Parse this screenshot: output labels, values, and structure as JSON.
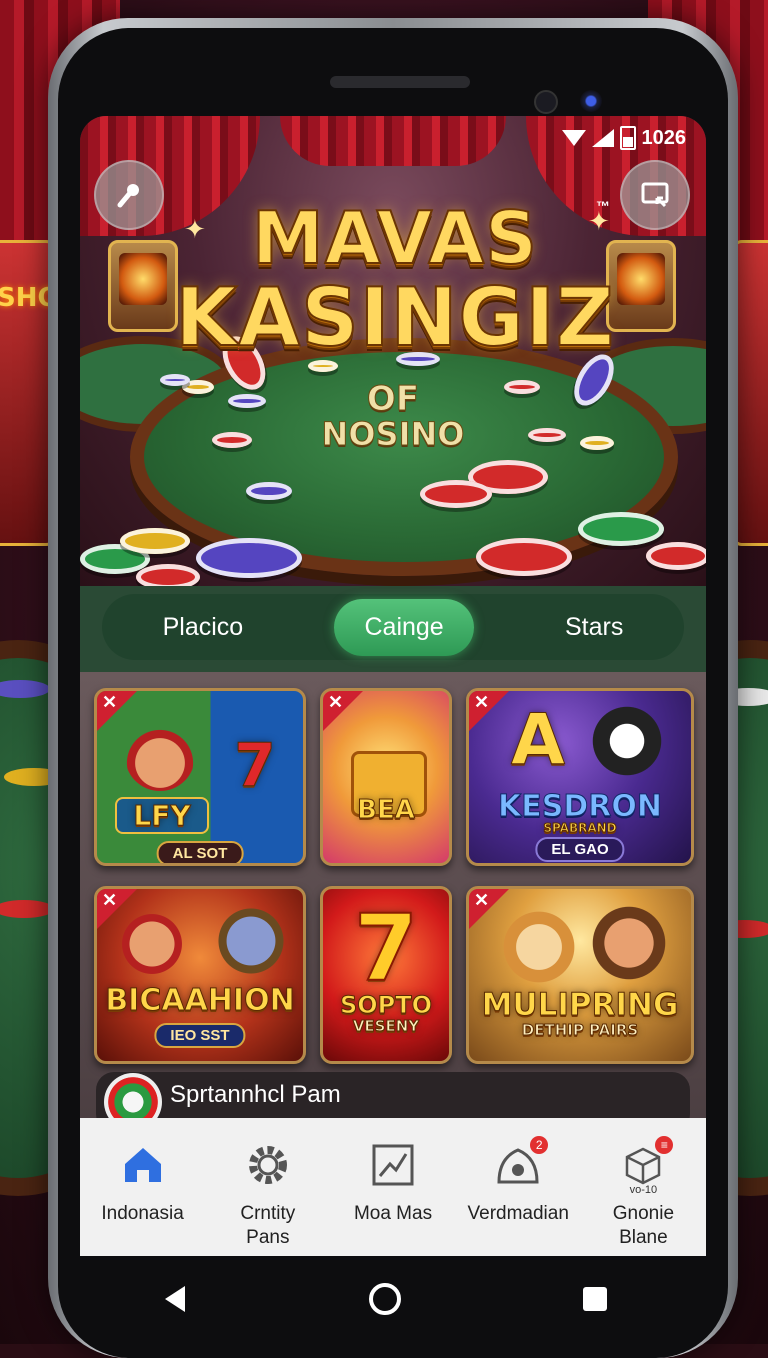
{
  "status_bar": {
    "time": "1026"
  },
  "hero": {
    "title_line1": "MAVAS",
    "trademark": "™",
    "title_line2": "KASINGIZ",
    "subtitle_line1": "OF",
    "subtitle_line2": "NOSINO",
    "left_button_icon": "wand-icon",
    "right_button_icon": "cast-icon"
  },
  "background": {
    "neon_sign": "SHO"
  },
  "tabs": [
    {
      "label": "Placico",
      "active": false
    },
    {
      "label": "Cainge",
      "active": true
    },
    {
      "label": "Stars",
      "active": false
    }
  ],
  "games": [
    {
      "top_text": "LFY",
      "pill": "AL SOT",
      "side_symbol": "7"
    },
    {
      "top_text": "BEA",
      "pill": ""
    },
    {
      "top_text": "A",
      "name": "KESDRON",
      "sub": "SPABRAND",
      "pill": "EL GAO"
    },
    {
      "top_text": "BICAAHION",
      "pill": "IEO SST"
    },
    {
      "top_text": "7",
      "name": "SOPTO",
      "sub": "VESENY"
    },
    {
      "top_text": "MULIPRING",
      "sub": "DETHIP PAIRS"
    }
  ],
  "promo": {
    "text": "Sprtannhcl Pam"
  },
  "bottom_nav": [
    {
      "label": "Indonasia",
      "icon": "home-icon",
      "active": true
    },
    {
      "label": "Crntity\nPans",
      "icon": "gear-icon",
      "active": false
    },
    {
      "label": "Moa Mas",
      "icon": "map-icon",
      "active": false
    },
    {
      "label": "Verdmadian",
      "icon": "bag-icon",
      "active": false,
      "badge": "2"
    },
    {
      "label": "Gnonie\nBlane",
      "icon": "box-icon",
      "active": false,
      "badge": "≡",
      "icon_caption": "vo-10"
    }
  ],
  "colors": {
    "accent": "#3fb266",
    "felt": "#2a6a35",
    "gold": "#ffd860",
    "badge": "#e23030"
  }
}
